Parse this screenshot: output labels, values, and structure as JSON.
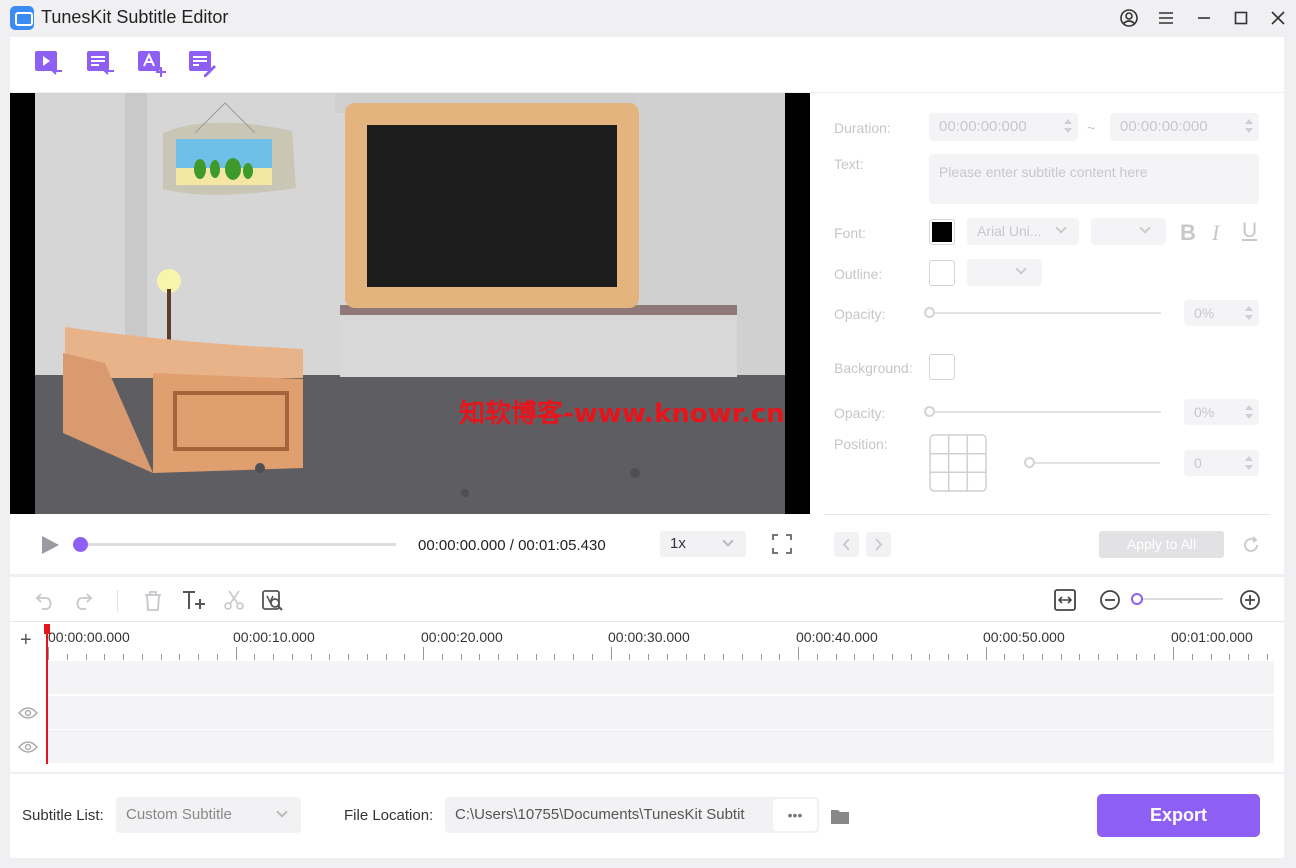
{
  "window": {
    "title": "TunesKit Subtitle Editor"
  },
  "toolbar": {
    "import_video_icon": "video-import-icon",
    "import_subtitle_icon": "subtitle-import-icon",
    "add_text_icon": "add-text-icon",
    "edit_subtitle_icon": "edit-subtitle-icon"
  },
  "player": {
    "current_time": "00:00:00.000",
    "total_time": "00:01:05.430",
    "time_display": "00:00:00.000 / 00:01:05.430",
    "speed": "1x",
    "progress": 0
  },
  "panel": {
    "duration_label": "Duration:",
    "duration_start": "00:00:00:000",
    "duration_sep": "~",
    "duration_end": "00:00:00:000",
    "text_label": "Text:",
    "text_placeholder": "Please enter subtitle content here",
    "font_label": "Font:",
    "font_name": "Arial Uni...",
    "bold": "B",
    "italic": "I",
    "underline": "U",
    "outline_label": "Outline:",
    "opacity_label": "Opacity:",
    "opacity_value": "0%",
    "background_label": "Background:",
    "opacity2_label": "Opacity:",
    "opacity2_value": "0%",
    "position_label": "Position:",
    "position_value": "0",
    "apply_all": "Apply to All",
    "colors": {
      "font_color": "#000000"
    }
  },
  "timeline": {
    "ticks": [
      "00:00:00.000",
      "00:00:10.000",
      "00:00:20.000",
      "00:00:30.000",
      "00:00:40.000",
      "00:00:50.000",
      "00:01:00.000"
    ],
    "add": "+"
  },
  "bottom": {
    "subtitle_list_label": "Subtitle List:",
    "subtitle_list_value": "Custom Subtitle",
    "file_location_label": "File Location:",
    "file_location_value": "C:\\Users\\10755\\Documents\\TunesKit Subtit",
    "more": "•••",
    "export": "Export"
  },
  "watermark": "知软博客-www.knowr.cn",
  "accent": "#8e5ff5"
}
